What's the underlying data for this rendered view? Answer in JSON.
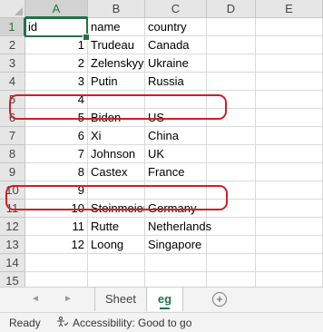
{
  "columns": [
    "A",
    "B",
    "C",
    "D",
    "E"
  ],
  "row_numbers": [
    "1",
    "2",
    "3",
    "4",
    "5",
    "6",
    "7",
    "8",
    "9",
    "10",
    "11",
    "12",
    "13",
    "14",
    "15"
  ],
  "rows": [
    [
      "id",
      "name",
      "country"
    ],
    [
      "1",
      "Trudeau",
      "Canada"
    ],
    [
      "2",
      "Zelenskyy",
      "Ukraine"
    ],
    [
      "3",
      "Putin",
      "Russia"
    ],
    [
      "4",
      "",
      ""
    ],
    [
      "5",
      "Biden",
      "US"
    ],
    [
      "6",
      "Xi",
      "China"
    ],
    [
      "7",
      "Johnson",
      "UK"
    ],
    [
      "8",
      "Castex",
      "France"
    ],
    [
      "9",
      "",
      ""
    ],
    [
      "10",
      "Steinmeier",
      "Germany"
    ],
    [
      "11",
      "Rutte",
      "Netherlands"
    ],
    [
      "12",
      "Loong",
      "Singapore"
    ],
    [
      "",
      "",
      ""
    ],
    [
      "",
      "",
      ""
    ]
  ],
  "sheet_tabs": [
    "Sheet",
    "eg"
  ],
  "active_sheet": "eg",
  "add_sheet_symbol": "+",
  "nav_prev": "◄",
  "nav_next": "►",
  "status": {
    "ready": "Ready",
    "accessibility": "Accessibility: Good to go"
  },
  "colors": {
    "accent": "#217346",
    "highlight": "#d01f24"
  }
}
